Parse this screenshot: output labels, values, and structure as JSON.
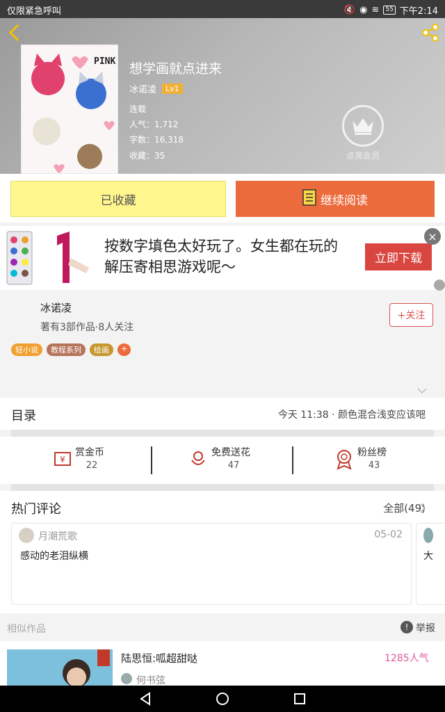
{
  "status_bar": {
    "left_text": "仅限紧急呼叫",
    "battery": "55",
    "time": "下午2:14"
  },
  "book": {
    "title": "想学画就点进来",
    "author": "冰诺凌",
    "author_level": "Lv1",
    "status": "连载",
    "popularity": "人气：1,712",
    "word_count": "字数：16,318",
    "favorites": "收藏：35",
    "vip_label": "点亮会员",
    "cover_text": "PINK"
  },
  "actions": {
    "favorited_label": "已收藏",
    "continue_label": "继续阅读"
  },
  "ad": {
    "text": "按数字填色太好玩了。女生都在玩的解压寄相思游戏呢～",
    "download_label": "立即下载",
    "close_glyph": "×"
  },
  "author_section": {
    "name": "冰诺凌",
    "info": "著有3部作品·8人关注",
    "follow_label": "+关注",
    "tags": [
      {
        "label": "轻小说",
        "color": "#f0a030"
      },
      {
        "label": "教程系列",
        "color": "#b5735a"
      },
      {
        "label": "绘画",
        "color": "#c8962d"
      },
      {
        "label": "+",
        "color": "#ec6b3c"
      }
    ]
  },
  "catalog": {
    "title": "目录",
    "latest": "今天 11:38 · 颜色混合浅变应该吧"
  },
  "rewards": [
    {
      "label": "赏金币",
      "value": "22",
      "icon": "coin-icon"
    },
    {
      "label": "免费送花",
      "value": "47",
      "icon": "flower-icon"
    },
    {
      "label": "粉丝榜",
      "value": "43",
      "icon": "medal-icon"
    }
  ],
  "comments": {
    "title": "热门评论",
    "all_label": "全部(49)",
    "items": [
      {
        "user": "月潮荒歌",
        "date": "05-02",
        "text": "感动的老泪纵横"
      },
      {
        "text": "大"
      }
    ]
  },
  "similar": {
    "title": "相似作品",
    "report_label": "举报",
    "items": [
      {
        "title": "陆思恒:呱超甜哒",
        "author": "何书弦",
        "popularity": "1285人气"
      }
    ]
  },
  "colors": {
    "accent": "#ec6b3c",
    "favorite_bg": "#fff68e",
    "ad_button": "#d9453f",
    "popularity_text": "#e0569a"
  }
}
